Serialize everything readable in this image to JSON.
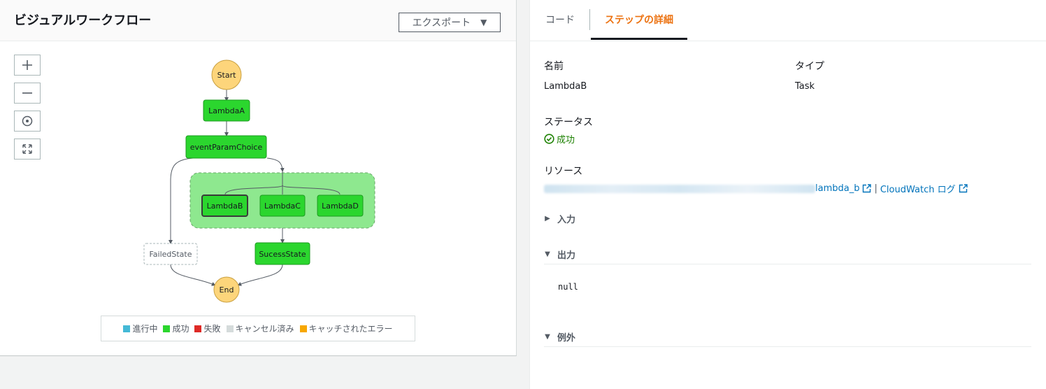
{
  "left_panel": {
    "title": "ビジュアルワークフロー",
    "export_label": "エクスポート"
  },
  "workflow": {
    "nodes": {
      "start": "Start",
      "lambda_a": "LambdaA",
      "choice": "eventParamChoice",
      "lambda_b": "LambdaB",
      "lambda_c": "LambdaC",
      "lambda_d": "LambdaD",
      "failed": "FailedState",
      "success": "SucessState",
      "end": "End"
    }
  },
  "legend": [
    {
      "label": "進行中",
      "color": "#44b9d6"
    },
    {
      "label": "成功",
      "color": "#2bd62e"
    },
    {
      "label": "失敗",
      "color": "#de2a26"
    },
    {
      "label": "キャンセル済み",
      "color": "#d5dbdb"
    },
    {
      "label": "キャッチされたエラー",
      "color": "#f7a700"
    }
  ],
  "colors": {
    "success_node": "#2bd62e",
    "parallel_group": "#8ee88f",
    "start_end": "#fdd57b",
    "accent_tab": "#ec7211",
    "link": "#0073bb",
    "status_success": "#1d8102"
  },
  "right_panel": {
    "tabs": {
      "code": "コード",
      "details": "ステップの詳細"
    },
    "name_label": "名前",
    "name_value": "LambdaB",
    "type_label": "タイプ",
    "type_value": "Task",
    "status_label": "ステータス",
    "status_value": "成功",
    "resource_label": "リソース",
    "resource_link": "lambda_b",
    "separator": "|",
    "cloudwatch_link": "CloudWatch ログ",
    "input_label": "入力",
    "output_label": "出力",
    "output_value": "null",
    "exception_label": "例外"
  }
}
